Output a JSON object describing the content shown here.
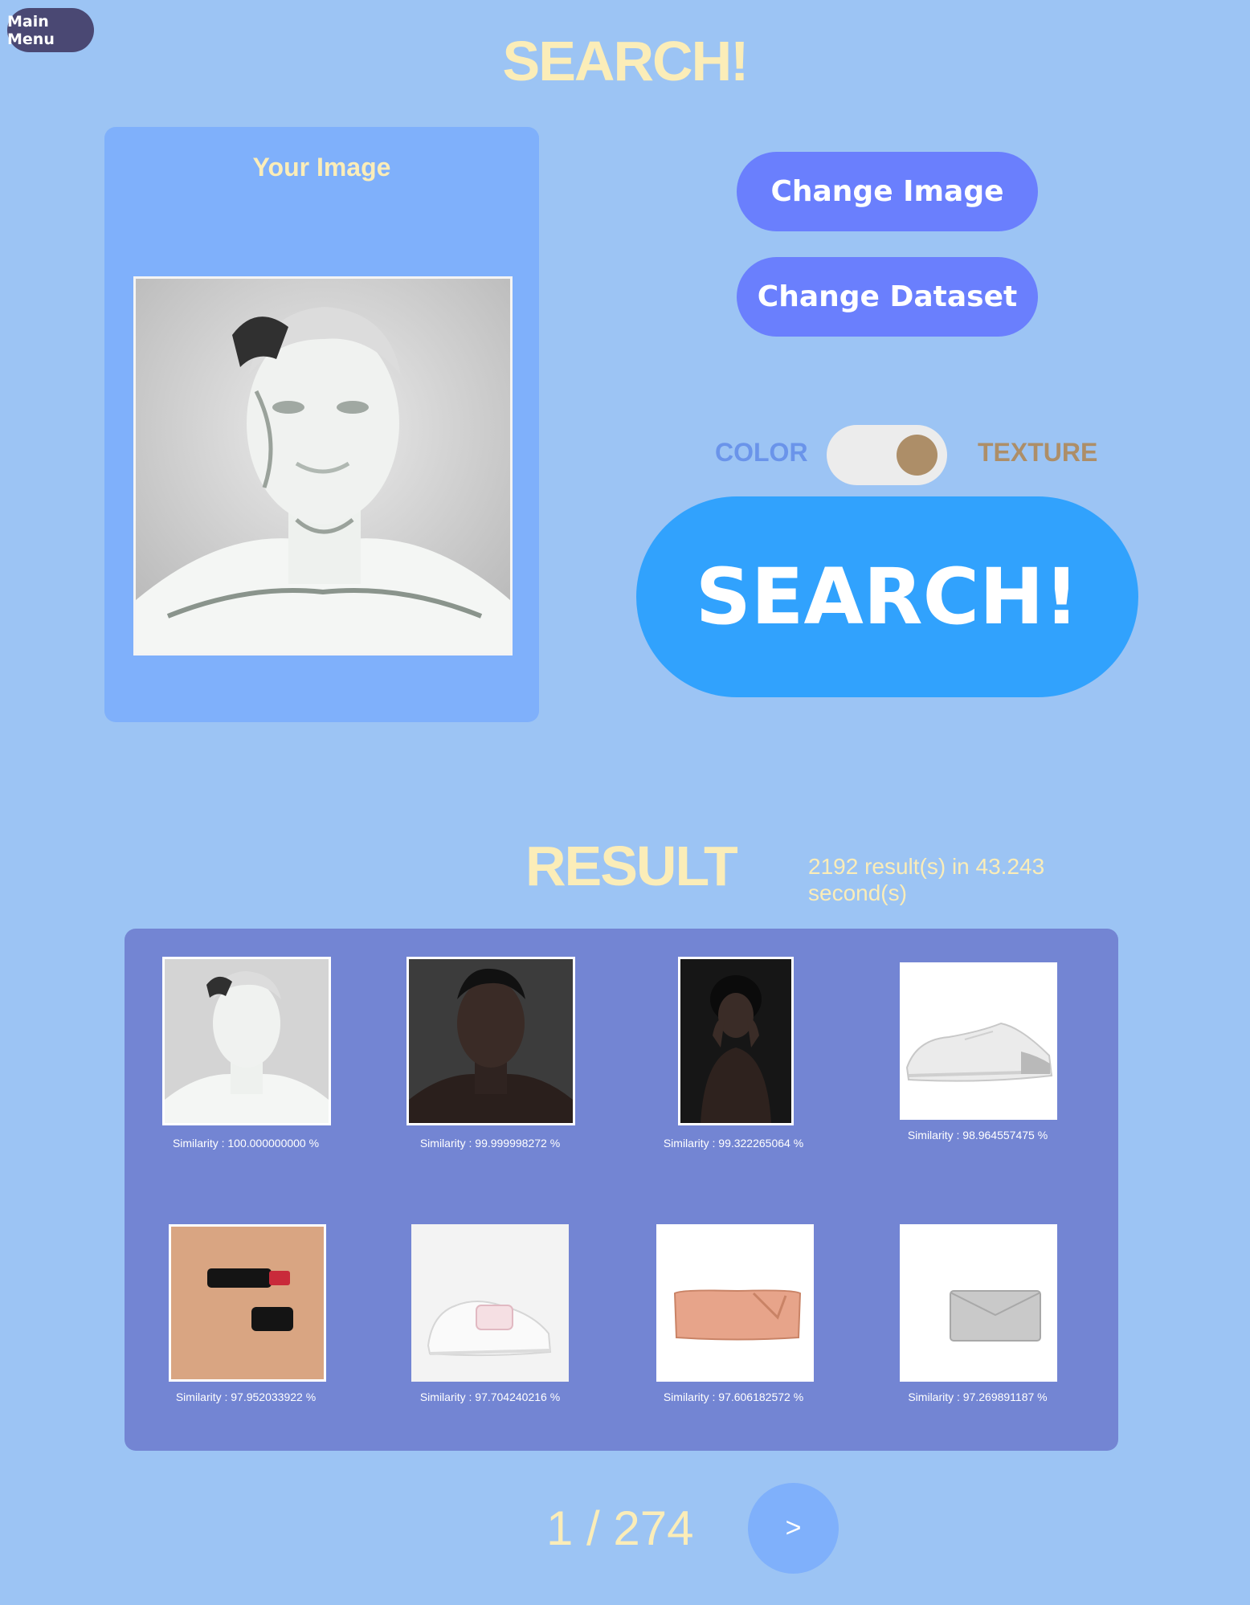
{
  "nav": {
    "main_menu_label": "Main Menu"
  },
  "header": {
    "title": "SEARCH!"
  },
  "query_panel": {
    "title": "Your Image"
  },
  "controls": {
    "change_image_label": "Change Image",
    "change_dataset_label": "Change Dataset",
    "toggle_left_label": "COLOR",
    "toggle_right_label": "TEXTURE",
    "toggle_state": "TEXTURE",
    "search_label": "SEARCH!"
  },
  "results": {
    "title": "RESULT",
    "stats": "2192 result(s) in 43.243 second(s)",
    "items": [
      {
        "similarity": "Similarity : 100.000000000 %",
        "thumbnail": "inverted-portrait"
      },
      {
        "similarity": "Similarity : 99.999998272 %",
        "thumbnail": "portrait"
      },
      {
        "similarity": "Similarity : 99.322265064 %",
        "thumbnail": "dark-portrait"
      },
      {
        "similarity": "Similarity : 98.964557475 %",
        "thumbnail": "white-sneaker"
      },
      {
        "similarity": "Similarity : 97.952033922 %",
        "thumbnail": "lipstick"
      },
      {
        "similarity": "Similarity : 97.704240216 %",
        "thumbnail": "kids-sneaker"
      },
      {
        "similarity": "Similarity : 97.606182572 %",
        "thumbnail": "peach-clutch"
      },
      {
        "similarity": "Similarity : 97.269891187 %",
        "thumbnail": "silver-clutch"
      }
    ]
  },
  "pagination": {
    "indicator": "1 / 274",
    "next_label": ">"
  },
  "colors": {
    "background": "#9cc4f4",
    "accent_yellow": "#fbedb8",
    "button_blue": "#6a7ffd",
    "search_blue": "#31a2fd",
    "result_panel": "#7385d3",
    "color_label": "#6a94ea",
    "texture_label": "#ad8e68"
  }
}
